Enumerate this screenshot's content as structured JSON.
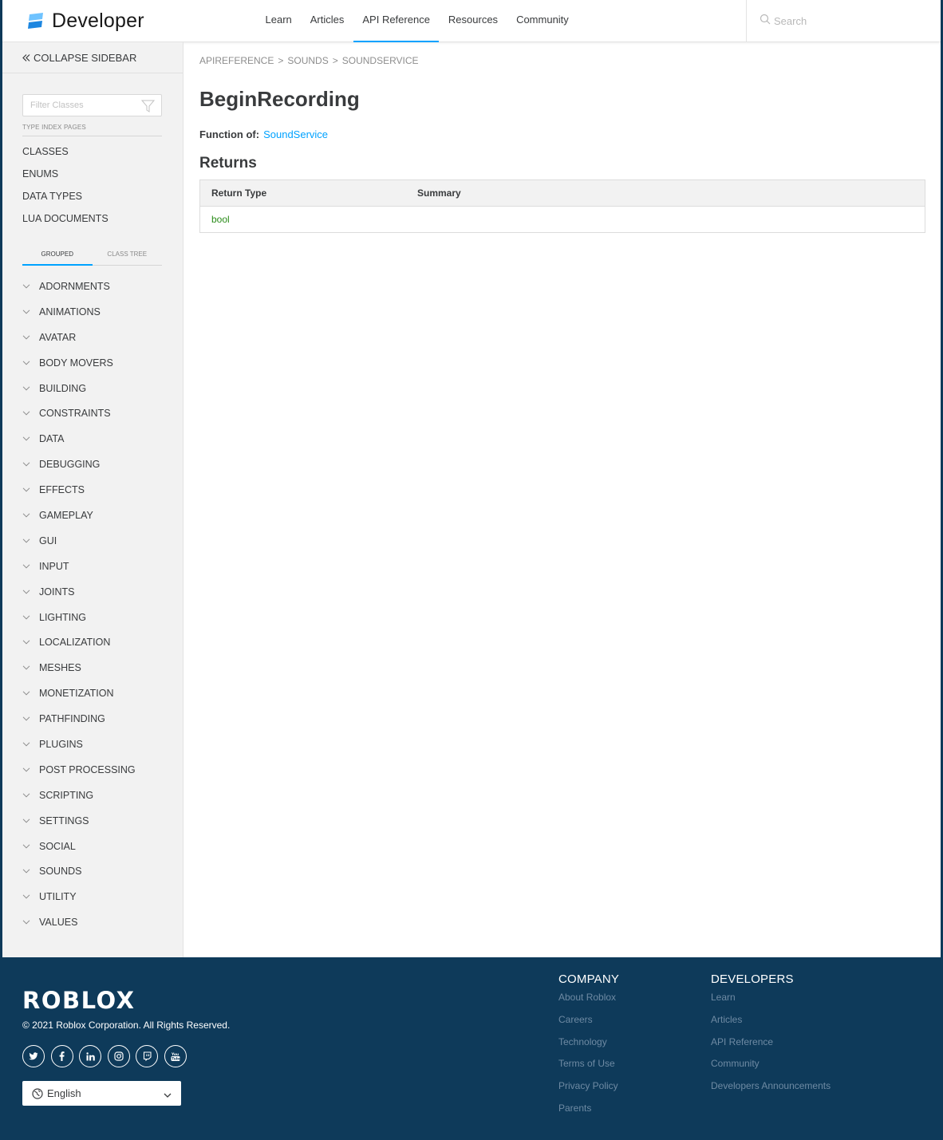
{
  "header": {
    "logo_text": "Developer",
    "nav": [
      "Learn",
      "Articles",
      "API Reference",
      "Resources",
      "Community"
    ],
    "active_nav": "API Reference",
    "search_placeholder": "Search"
  },
  "sidebar": {
    "collapse_label": "COLLAPSE SIDEBAR",
    "filter_placeholder": "Filter Classes",
    "type_index_label": "TYPE INDEX PAGES",
    "type_links": [
      "CLASSES",
      "ENUMS",
      "DATA TYPES",
      "LUA DOCUMENTS"
    ],
    "view_tabs": [
      "GROUPED",
      "CLASS TREE"
    ],
    "groups": [
      "ADORNMENTS",
      "ANIMATIONS",
      "AVATAR",
      "BODY MOVERS",
      "BUILDING",
      "CONSTRAINTS",
      "DATA",
      "DEBUGGING",
      "EFFECTS",
      "GAMEPLAY",
      "GUI",
      "INPUT",
      "JOINTS",
      "LIGHTING",
      "LOCALIZATION",
      "MESHES",
      "MONETIZATION",
      "PATHFINDING",
      "PLUGINS",
      "POST PROCESSING",
      "SCRIPTING",
      "SETTINGS",
      "SOCIAL",
      "SOUNDS",
      "UTILITY",
      "VALUES"
    ]
  },
  "main": {
    "breadcrumb": [
      "APIREFERENCE",
      "SOUNDS",
      "SOUNDSERVICE"
    ],
    "breadcrumb_sep": ">",
    "title": "BeginRecording",
    "function_of_label": "Function of:",
    "function_of_value": "SoundService",
    "returns_heading": "Returns",
    "table": {
      "headers": [
        "Return Type",
        "Summary"
      ],
      "rows": [
        {
          "type": "bool",
          "summary": ""
        }
      ]
    }
  },
  "footer": {
    "brand": "ROBLOX",
    "copyright": "© 2021 Roblox Corporation. All Rights Reserved.",
    "socials": [
      "twitter-icon",
      "facebook-icon",
      "linkedin-icon",
      "instagram-icon",
      "twitch-icon",
      "youtube-icon"
    ],
    "language": "English",
    "company": {
      "title": "COMPANY",
      "links": [
        "About Roblox",
        "Careers",
        "Technology",
        "Terms of Use",
        "Privacy Policy",
        "Parents"
      ]
    },
    "developers": {
      "title": "DEVELOPERS",
      "links": [
        "Learn",
        "Articles",
        "API Reference",
        "Community",
        "Developers Announcements"
      ]
    }
  },
  "colors": {
    "accent": "#00a2ff",
    "footer_bg": "#0e3a5a",
    "return_type": "#2b8c1a"
  }
}
